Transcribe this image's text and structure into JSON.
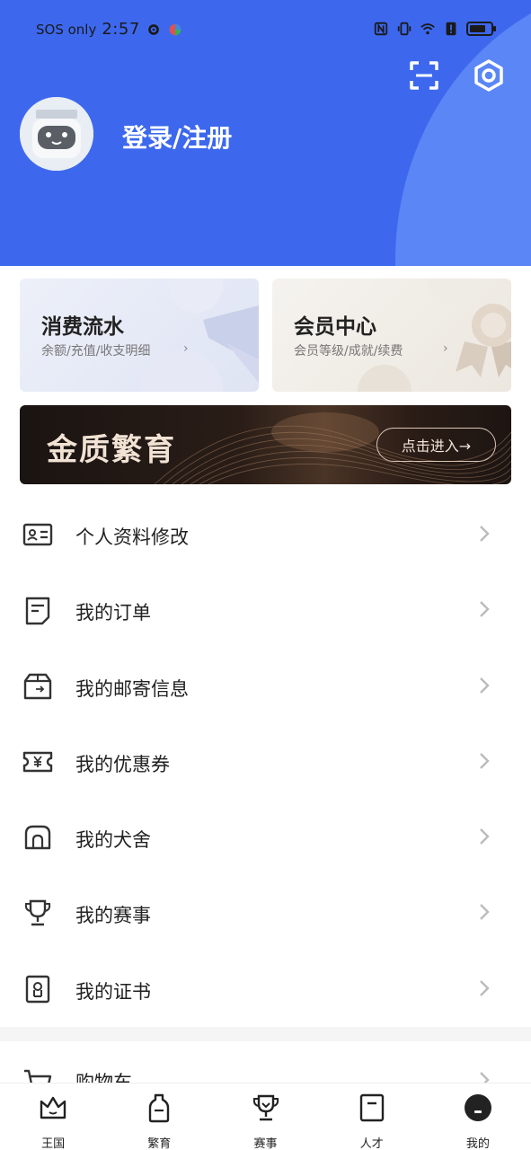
{
  "status_bar": {
    "carrier": "SOS only",
    "time": "2:57"
  },
  "header": {
    "login_label": "登录/注册",
    "scan_icon": "scan-icon",
    "settings_icon": "settings-icon",
    "colors": {
      "background": "#3d68ee",
      "arc": "#5a86f6"
    }
  },
  "cards": [
    {
      "title": "消费流水",
      "subtitle": "余额/充值/收支明细",
      "chevron": "›"
    },
    {
      "title": "会员中心",
      "subtitle": "会员等级/成就/续费",
      "chevron": "›"
    }
  ],
  "banner": {
    "title": "金质繁育",
    "button_label": "点击进入→"
  },
  "menu": [
    {
      "label": "个人资料修改",
      "icon": "id-card-icon"
    },
    {
      "label": "我的订单",
      "icon": "order-icon"
    },
    {
      "label": "我的邮寄信息",
      "icon": "package-icon"
    },
    {
      "label": "我的优惠券",
      "icon": "coupon-icon"
    },
    {
      "label": "我的犬舍",
      "icon": "kennel-icon"
    },
    {
      "label": "我的赛事",
      "icon": "trophy-icon"
    },
    {
      "label": "我的证书",
      "icon": "certificate-icon"
    }
  ],
  "partial_menu": {
    "label": "购物车",
    "icon": "cart-icon"
  },
  "bottom_nav": [
    {
      "label": "王国",
      "icon": "crown-icon"
    },
    {
      "label": "繁育",
      "icon": "bottle-icon"
    },
    {
      "label": "赛事",
      "icon": "trophy-icon"
    },
    {
      "label": "人才",
      "icon": "badge-icon"
    },
    {
      "label": "我的",
      "icon": "profile-icon",
      "active": true
    }
  ]
}
